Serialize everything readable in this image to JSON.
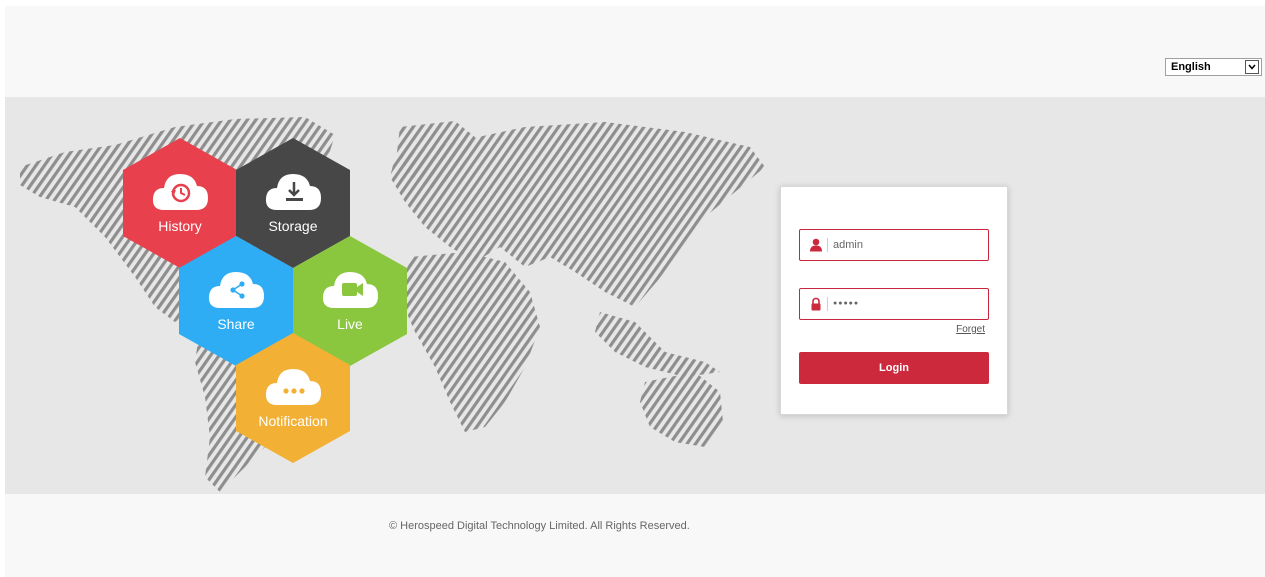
{
  "language": {
    "selected": "English",
    "icon": "chevron-down-icon"
  },
  "features": [
    {
      "id": "history",
      "label": "History",
      "color": "#e8404c",
      "icon": "history-icon"
    },
    {
      "id": "storage",
      "label": "Storage",
      "color": "#474747",
      "icon": "download-icon"
    },
    {
      "id": "share",
      "label": "Share",
      "color": "#2eadf4",
      "icon": "share-icon"
    },
    {
      "id": "live",
      "label": "Live",
      "color": "#8bc63f",
      "icon": "video-camera-icon"
    },
    {
      "id": "notification",
      "label": "Notification",
      "color": "#f2b135",
      "icon": "ellipsis-icon"
    }
  ],
  "login": {
    "username_value": "admin",
    "username_icon": "user-icon",
    "password_value": "●●●●●",
    "password_icon": "lock-icon",
    "forget_label": "Forget",
    "login_label": "Login",
    "accent": "#cc2a3c"
  },
  "footer": {
    "copyright": "©  Herospeed Digital Technology Limited.  All Rights Reserved."
  }
}
